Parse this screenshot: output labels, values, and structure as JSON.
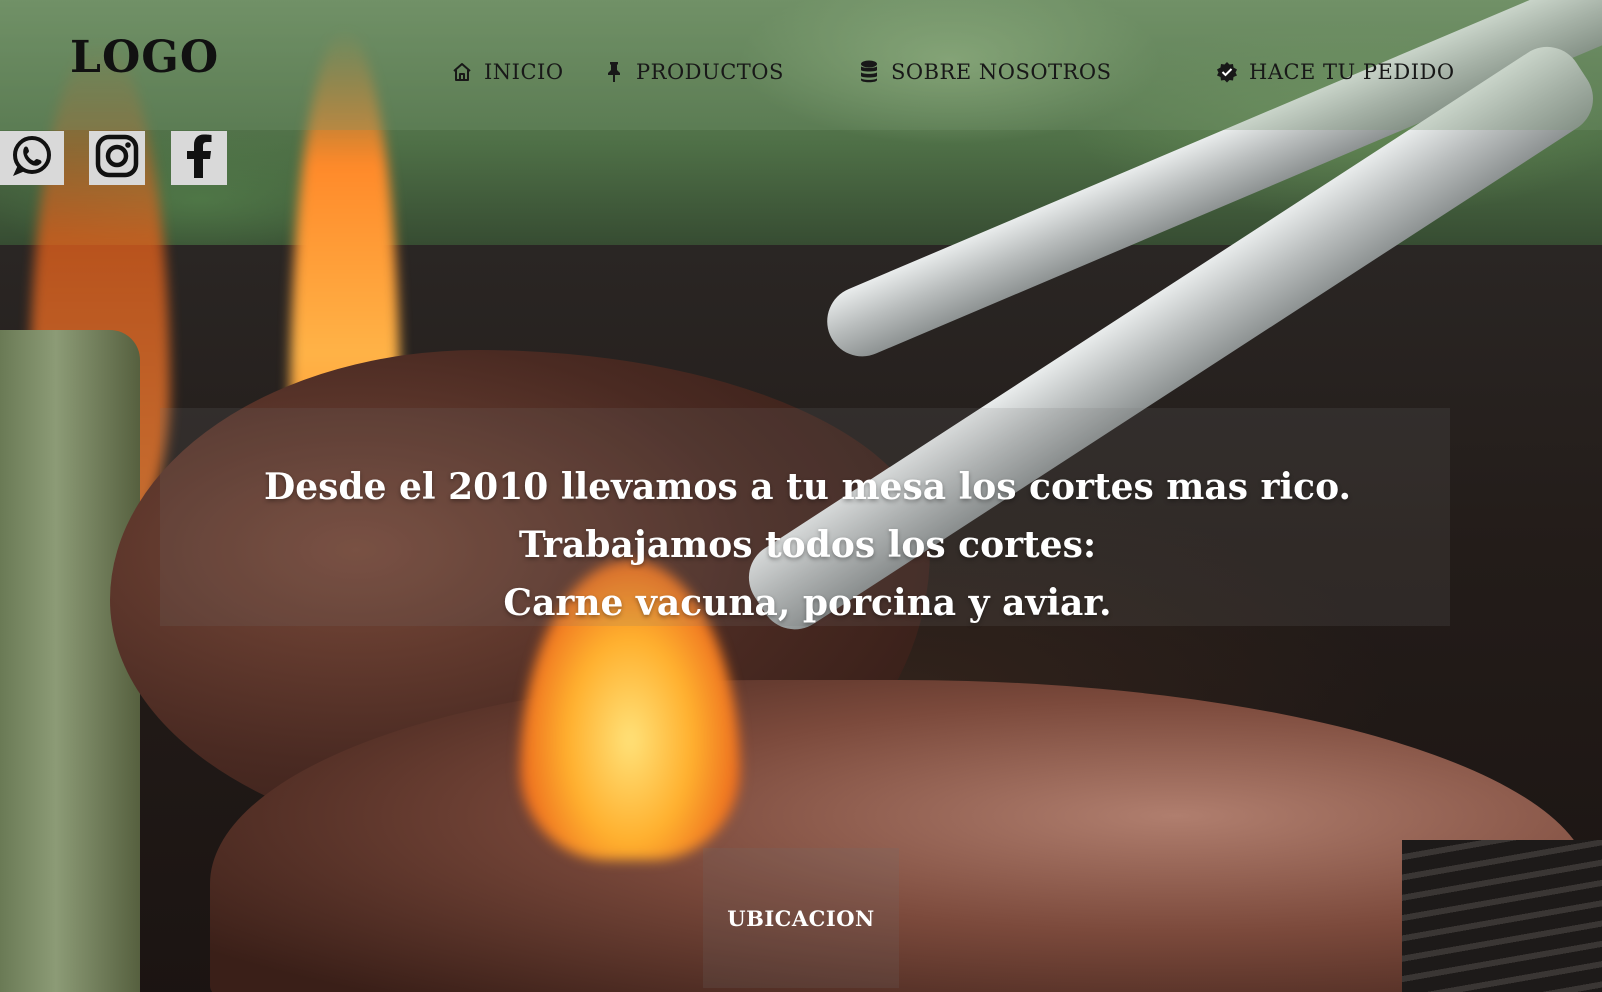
{
  "header": {
    "logo": "LOGO",
    "nav": [
      {
        "label": "INICIO",
        "icon": "home-icon"
      },
      {
        "label": "PRODUCTOS",
        "icon": "pin-icon"
      },
      {
        "label": "SOBRE NOSOTROS",
        "icon": "database-icon"
      },
      {
        "label": "HACE TU PEDIDO",
        "icon": "badge-check-icon"
      }
    ]
  },
  "social": [
    {
      "icon": "whatsapp-icon"
    },
    {
      "icon": "instagram-icon"
    },
    {
      "icon": "facebook-icon"
    }
  ],
  "hero": {
    "lines": [
      "Desde el 2010 llevamos a tu mesa los cortes mas rico.",
      "Trabajamos todos los cortes:",
      "Carne vacuna, porcina y aviar."
    ]
  },
  "location_button": "UBICACION",
  "colors": {
    "nav_text": "#181818",
    "hero_text": "#ffffff",
    "social_bg": "#d9d9d9"
  }
}
